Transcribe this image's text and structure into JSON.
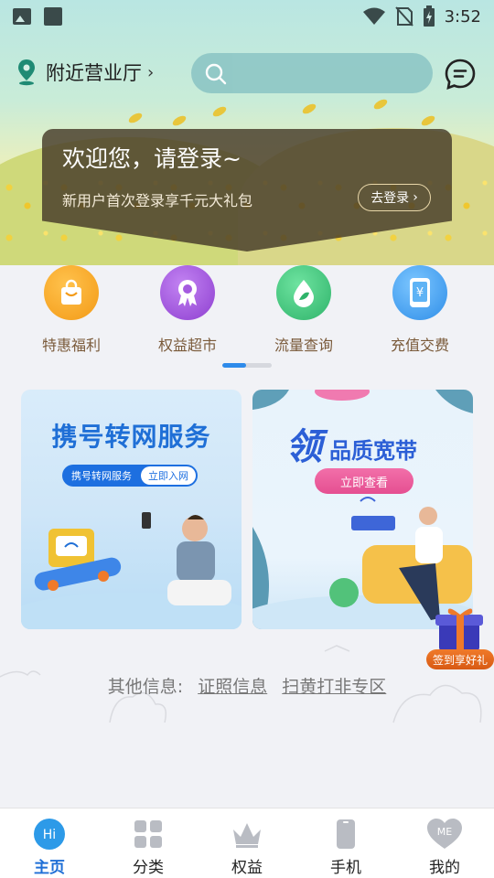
{
  "status_bar": {
    "time": "3:52",
    "icons": [
      "image-icon",
      "square-icon",
      "wifi-icon",
      "no-sim-icon",
      "battery-charging-icon"
    ]
  },
  "header": {
    "location_label": "附近营业厅",
    "search_placeholder": ""
  },
  "login_card": {
    "welcome": "欢迎您，请登录~",
    "gift_text": "新用户首次登录享千元大礼包",
    "login_button": "去登录"
  },
  "quick_links": [
    {
      "label": "特惠福利",
      "icon": "shopping-bag-icon",
      "color": "#f6a11f"
    },
    {
      "label": "权益超市",
      "icon": "ribbon-badge-icon",
      "color": "#9d4fd8"
    },
    {
      "label": "流量查询",
      "icon": "leaf-drop-icon",
      "color": "#3cc07a"
    },
    {
      "label": "充值交费",
      "icon": "phone-yuan-icon",
      "color": "#3a9cf0"
    }
  ],
  "banners": {
    "left": {
      "title": "携号转网服务",
      "pill_text": "携号转网服务",
      "pill_button": "立即入网"
    },
    "right": {
      "title_big": "领",
      "title_small": "品质宽带",
      "button": "立即查看"
    }
  },
  "sign_in_gift": "签到享好礼",
  "other_info": {
    "label": "其他信息:",
    "links": [
      "证照信息",
      "扫黄打非专区"
    ]
  },
  "bottom_nav": [
    {
      "label": "主页",
      "icon": "hi-icon",
      "active": true
    },
    {
      "label": "分类",
      "icon": "grid-icon",
      "active": false
    },
    {
      "label": "权益",
      "icon": "crown-icon",
      "active": false
    },
    {
      "label": "手机",
      "icon": "phone-icon",
      "active": false
    },
    {
      "label": "我的",
      "icon": "me-heart-icon",
      "active": false
    }
  ],
  "colors": {
    "accent": "#1f6fd6",
    "search_bg": "#90c8c6",
    "quick_label": "#7a5a3a"
  }
}
